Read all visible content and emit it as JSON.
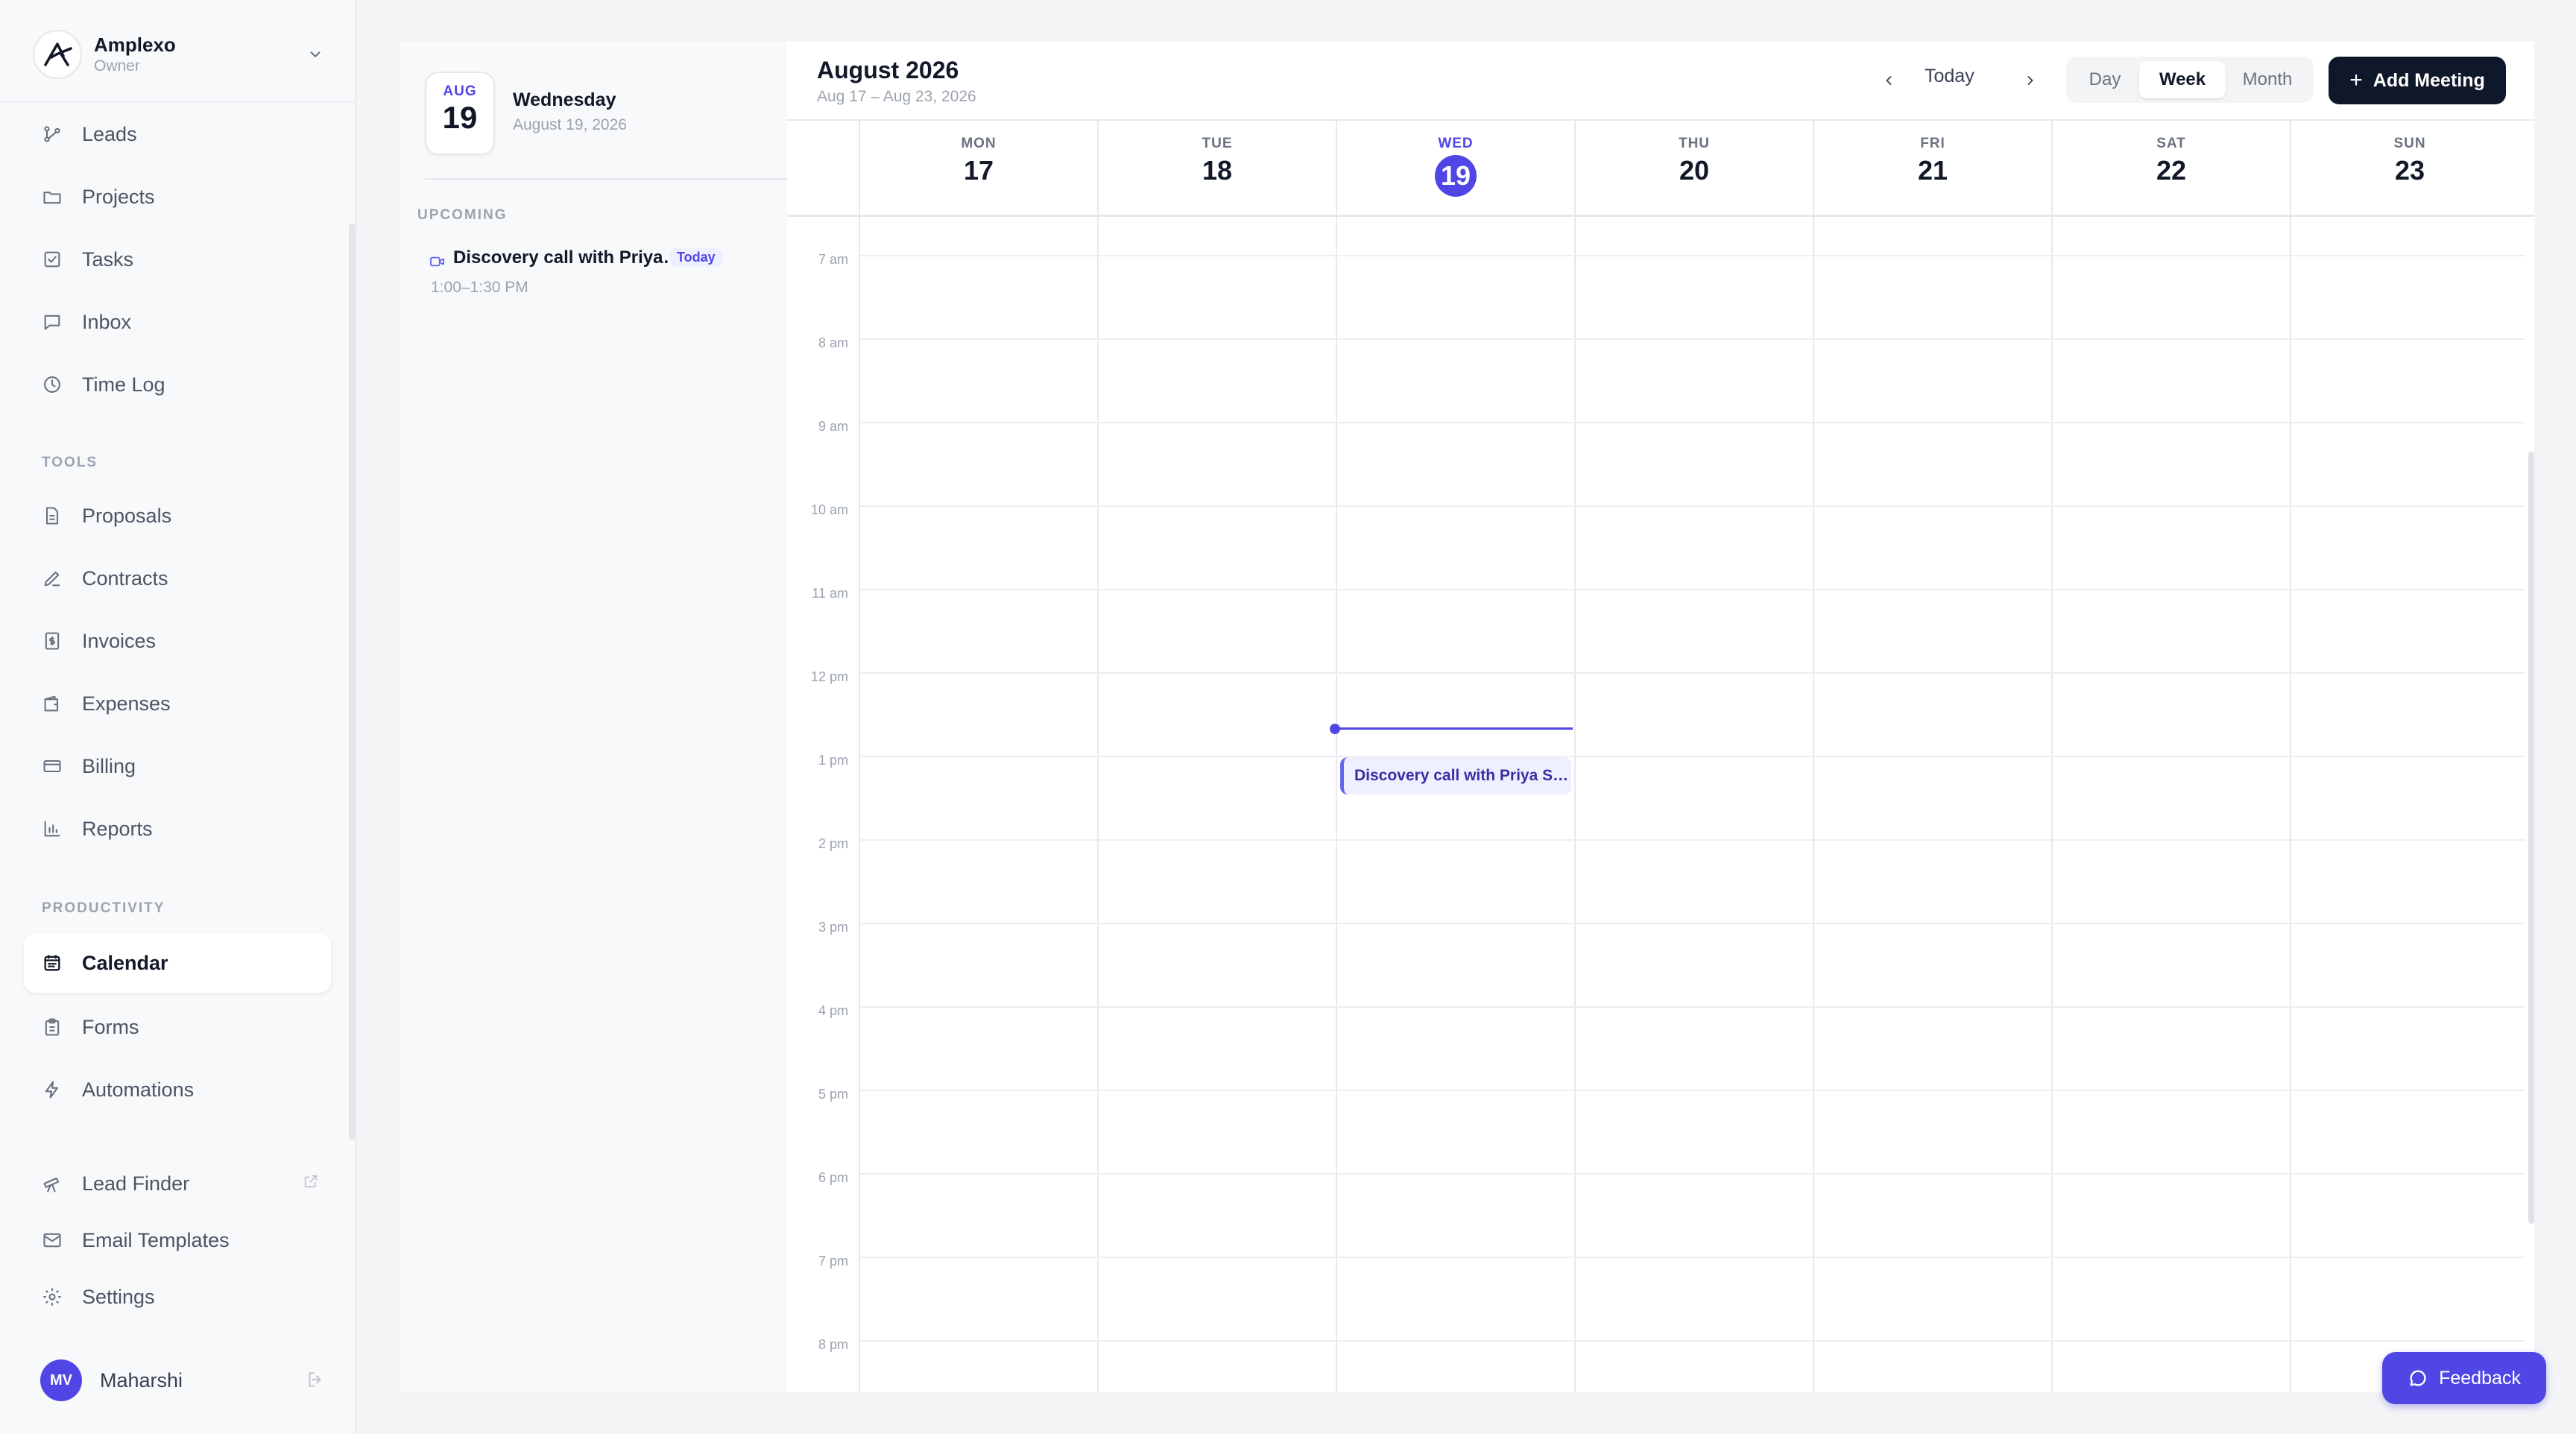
{
  "workspace": {
    "name": "Amplexo",
    "role": "Owner"
  },
  "sidebar": {
    "main_items": [
      {
        "label": "Leads",
        "icon": "leads-icon"
      },
      {
        "label": "Projects",
        "icon": "folder-icon"
      },
      {
        "label": "Tasks",
        "icon": "checkbox-icon"
      },
      {
        "label": "Inbox",
        "icon": "message-icon"
      },
      {
        "label": "Time Log",
        "icon": "clock-icon"
      }
    ],
    "tools_title": "TOOLS",
    "tools_items": [
      {
        "label": "Proposals",
        "icon": "document-icon"
      },
      {
        "label": "Contracts",
        "icon": "pen-icon"
      },
      {
        "label": "Invoices",
        "icon": "invoice-icon"
      },
      {
        "label": "Expenses",
        "icon": "wallet-icon"
      },
      {
        "label": "Billing",
        "icon": "credit-card-icon"
      },
      {
        "label": "Reports",
        "icon": "bar-chart-icon"
      }
    ],
    "productivity_title": "PRODUCTIVITY",
    "productivity_items": [
      {
        "label": "Calendar",
        "icon": "calendar-icon",
        "active": true
      },
      {
        "label": "Forms",
        "icon": "clipboard-icon"
      },
      {
        "label": "Automations",
        "icon": "lightning-icon"
      }
    ],
    "bottom_items": [
      {
        "label": "Lead Finder",
        "icon": "telescope-icon",
        "external": true
      },
      {
        "label": "Email Templates",
        "icon": "mail-icon"
      },
      {
        "label": "Settings",
        "icon": "gear-icon"
      }
    ],
    "user": {
      "initials": "MV",
      "name": "Maharshi"
    }
  },
  "selected_date": {
    "month": "AUG",
    "day": "19",
    "weekday": "Wednesday",
    "full": "August 19, 2026"
  },
  "upcoming": {
    "title": "UPCOMING",
    "items": [
      {
        "title": "Discovery call with Priya Sharma",
        "badge": "Today",
        "time": "1:00–1:30 PM"
      }
    ]
  },
  "calendar": {
    "title": "August 2026",
    "range": "Aug 17 – Aug 23, 2026",
    "today_label": "Today",
    "views": [
      "Day",
      "Week",
      "Month"
    ],
    "active_view": "Week",
    "add_label": "Add Meeting",
    "days": [
      {
        "name": "MON",
        "num": "17"
      },
      {
        "name": "TUE",
        "num": "18"
      },
      {
        "name": "WED",
        "num": "19",
        "today": true
      },
      {
        "name": "THU",
        "num": "20"
      },
      {
        "name": "FRI",
        "num": "21"
      },
      {
        "name": "SAT",
        "num": "22"
      },
      {
        "name": "SUN",
        "num": "23"
      }
    ],
    "hours": [
      "7 am",
      "8 am",
      "9 am",
      "10 am",
      "11 am",
      "12 pm",
      "1 pm",
      "2 pm",
      "3 pm",
      "4 pm",
      "5 pm",
      "6 pm",
      "7 pm",
      "8 pm"
    ],
    "event": {
      "title": "Discovery call with Priya Sharma",
      "day": "WED",
      "start": "1:00 PM",
      "end": "1:30 PM"
    },
    "accent": "#4f46e5"
  },
  "feedback_label": "Feedback"
}
